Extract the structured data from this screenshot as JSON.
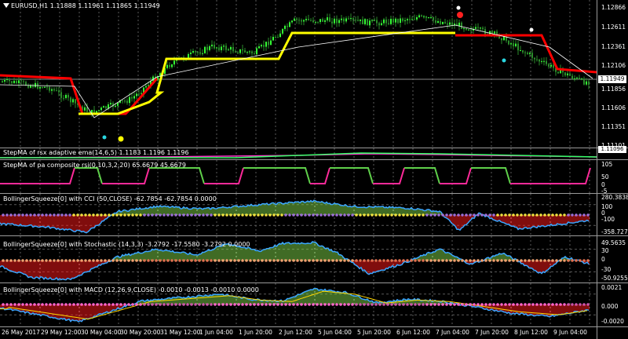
{
  "main": {
    "symbol": "EURUSD,H1",
    "ohlc": "1.11888 1.11961 1.11865 1.11949",
    "current_price": "1.11949",
    "price_labels": [
      "1.12866",
      "1.12611",
      "1.12361",
      "1.12106",
      "1.11856",
      "1.11606",
      "1.11351",
      "1.11101"
    ]
  },
  "indicators": [
    {
      "title": "StepMA of rsx adaptive ema(14,6,5) 1.1183 1.1196 1.1196",
      "labels": [
        "1.11096"
      ]
    },
    {
      "title": "StepMA of pa composite rsi(0,10,3,2,20) 65.6679 45.6679",
      "labels": [
        "105",
        "50",
        "0",
        "-5"
      ]
    },
    {
      "title": "BollingerSqueeze[0] with CCI (50,CLOSE) -62.7854 -62.7854 0.0000",
      "labels": [
        "280.3838",
        "100",
        "0",
        "-100",
        "-358.7275"
      ]
    },
    {
      "title": "BollingerSqueeze[0] with Stochastic (14,3,3) -3.2792 -17.5580 -3.2792 0.0000",
      "labels": [
        "49.5635",
        "30",
        "0",
        "-30",
        "-50.9255"
      ]
    },
    {
      "title": "BollingerSqueeze[0] with MACD (12,26,9,CLOSE) -0.0010 -0.0013 -0.0010 0.0000",
      "labels": [
        "0.0021",
        "0.000",
        "-0.0020"
      ]
    }
  ],
  "time_axis": [
    "26 May 2017",
    "29 May 12:00",
    "30 May 04:00",
    "30 May 20:00",
    "31 May 12:00",
    "1 Jun 04:00",
    "1 Jun 20:00",
    "2 Jun 12:00",
    "5 Jun 04:00",
    "5 Jun 20:00",
    "6 Jun 12:00",
    "7 Jun 04:00",
    "7 Jun 20:00",
    "8 Jun 12:00",
    "9 Jun 04:00"
  ],
  "colors": {
    "bull_candle": "#33ff33",
    "bear_candle": "#2b8c2b",
    "stepma_red": "#ff0000",
    "stepma_yellow": "#ffff00",
    "hist_pos": "#7fd64a",
    "hist_neg": "#ff1a1a",
    "signal_line": "#3aa6ff",
    "squeeze_dot": "#b38ad6",
    "squeeze_dot2": "#f0a080",
    "squeeze_dot3": "#ff66cc"
  },
  "chart_data": {
    "type": "line",
    "title": "EURUSD,H1",
    "ylim": [
      1.111,
      1.129
    ],
    "x": [
      "26 May 2017",
      "29 May 12:00",
      "30 May 04:00",
      "30 May 20:00",
      "31 May 12:00",
      "1 Jun 04:00",
      "1 Jun 20:00",
      "2 Jun 12:00",
      "5 Jun 04:00",
      "5 Jun 20:00",
      "6 Jun 12:00",
      "7 Jun 04:00",
      "7 Jun 20:00",
      "8 Jun 12:00",
      "9 Jun 04:00"
    ],
    "series": [
      {
        "values": [
          1.119,
          1.1182,
          1.115,
          1.1168,
          1.1215,
          1.1235,
          1.1226,
          1.1268,
          1.1268,
          1.1265,
          1.1272,
          1.1262,
          1.1248,
          1.1215,
          1.119
        ]
      }
    ]
  }
}
